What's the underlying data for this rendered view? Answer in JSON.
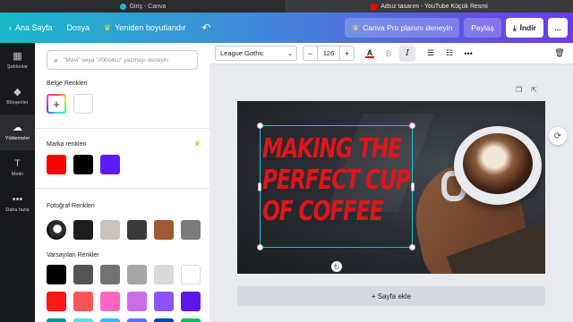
{
  "browser_tabs": [
    {
      "title": "Giriş - Canva",
      "active": false
    },
    {
      "title": "Adsız tasarım - YouTube Küçük Resmi",
      "active": true
    }
  ],
  "topbar": {
    "back_label": "Ana Sayfa",
    "file_label": "Dosya",
    "resize_label": "Yeniden boyutlandır",
    "pro_label": "Canva Pro planını deneyin",
    "share_label": "Paylaş",
    "download_label": "İndir",
    "more_label": "..."
  },
  "rail": [
    {
      "label": "Şablonlar",
      "icon": "templates-icon",
      "glyph": "▦"
    },
    {
      "label": "Bileşenler",
      "icon": "elements-icon",
      "glyph": "◆"
    },
    {
      "label": "Yüklemeler",
      "icon": "upload-icon",
      "glyph": "☁"
    },
    {
      "label": "Metin",
      "icon": "text-icon",
      "glyph": "T"
    },
    {
      "label": "Daha fazla",
      "icon": "more-icon",
      "glyph": "•••"
    }
  ],
  "panel": {
    "search_placeholder": "\"Mavi\" veya \"#00c4cc\" yazmayı deneyin",
    "doc_colors_title": "Belge Renkleri",
    "doc_colors": [
      "#ffffff"
    ],
    "brand_title": "Marka renkleri",
    "brand_colors": [
      "#ff0000",
      "#000000",
      "#5a1cff"
    ],
    "photo_title": "Fotoğraf Renkleri",
    "photo_colors": [
      "#1e1e1e",
      "#c9c3bd",
      "#3a3a3a",
      "#9c5b34",
      "#7c7c7c"
    ],
    "default_title": "Varsayılan Renkler",
    "default_row1": [
      "#000000",
      "#545454",
      "#737373",
      "#a6a6a6",
      "#d9d9d9",
      "#ffffff"
    ],
    "default_row2": [
      "#ff1616",
      "#ff5757",
      "#ff66c4",
      "#cb6ce6",
      "#8c52ff",
      "#5e17eb"
    ],
    "default_row3": [
      "#03989e",
      "#5ce1e6",
      "#38b6ff",
      "#5271ff",
      "#004aad",
      "#00bf63"
    ]
  },
  "texttool": {
    "font": "League Gothic",
    "size": "126",
    "color_label": "A",
    "bold_label": "B",
    "italic_label": "I",
    "decrease": "−",
    "increase": "+",
    "text_color": "#e30000"
  },
  "canvas": {
    "headline": "MAKING THE\nPERFECT CUP\nOF COFFEE",
    "add_page": "+ Sayfa ekle"
  }
}
